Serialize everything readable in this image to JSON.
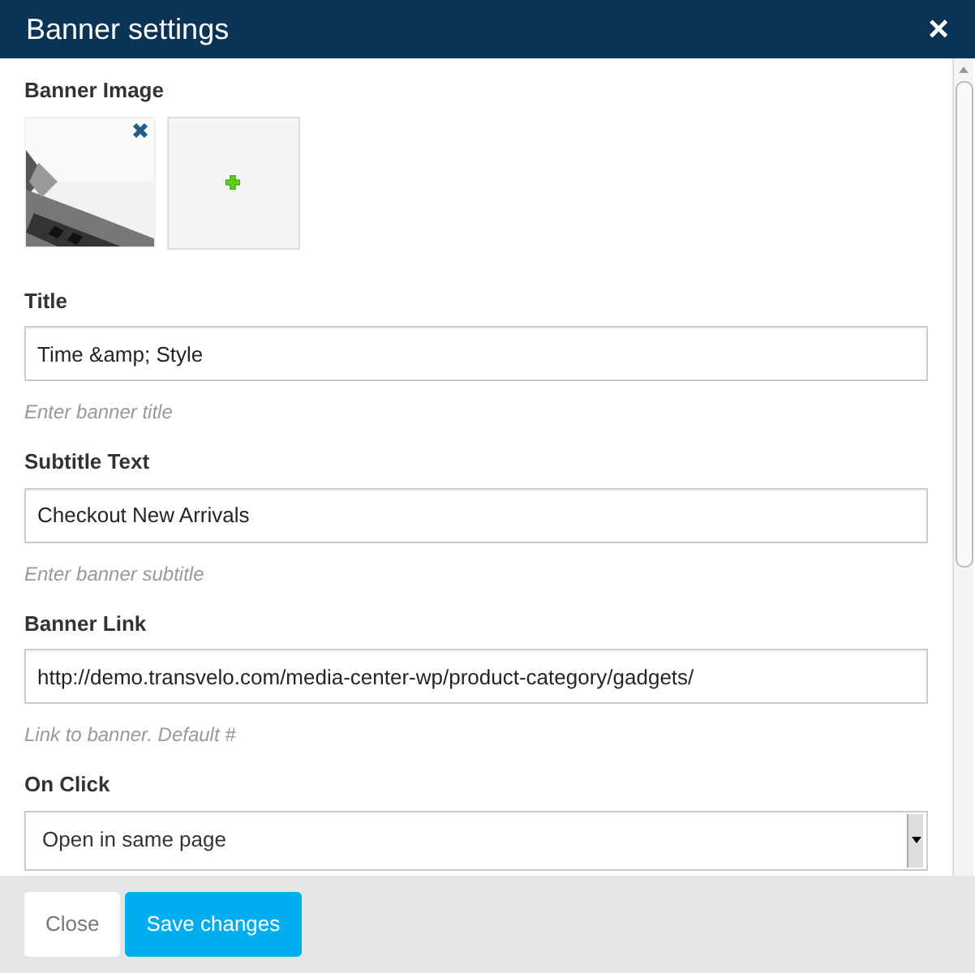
{
  "window": {
    "title": "Banner settings",
    "close": "×"
  },
  "banner_image": {
    "label": "Banner Image"
  },
  "fields": [
    {
      "kind": "text",
      "label": "Title",
      "value": "Time &amp; Style",
      "help": "Enter banner title"
    },
    {
      "kind": "text",
      "label": "Subtitle Text",
      "value": "Checkout New Arrivals",
      "help": "Enter banner subtitle"
    },
    {
      "kind": "text",
      "label": "Banner Link",
      "value": "http://demo.transvelo.com/media-center-wp/product-category/gadgets/",
      "help": "Link to banner. Default #"
    },
    {
      "kind": "select",
      "label": "On Click",
      "value": "Open in same page"
    }
  ],
  "buttons": [
    {
      "label": "Close",
      "kind": "default"
    },
    {
      "label": "Save changes",
      "kind": "primary"
    }
  ]
}
